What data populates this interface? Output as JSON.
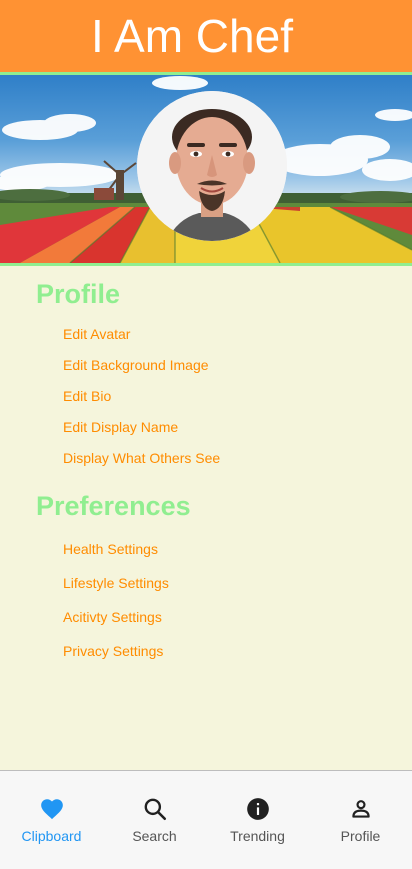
{
  "app": {
    "title": "I Am Chef"
  },
  "profile_section": {
    "title": "Profile",
    "items": [
      "Edit Avatar",
      "Edit Background Image",
      "Edit Bio",
      "Edit Display Name",
      "Display What Others See"
    ]
  },
  "preferences_section": {
    "title": "Preferences",
    "items": [
      "Health Settings",
      "Lifestyle Settings",
      "Acitivty Settings",
      "Privacy Settings"
    ]
  },
  "bottom_nav": {
    "items": [
      {
        "label": "Clipboard",
        "icon": "heart-icon",
        "active": true
      },
      {
        "label": "Search",
        "icon": "search-icon",
        "active": false
      },
      {
        "label": "Trending",
        "icon": "info-icon",
        "active": false
      },
      {
        "label": "Profile",
        "icon": "person-icon",
        "active": false
      }
    ]
  },
  "colors": {
    "header": "#ff9233",
    "accent_green": "#90ee90",
    "link_orange": "#ff8c00",
    "page_background": "#f5f5dc",
    "nav_active": "#2196f3"
  }
}
